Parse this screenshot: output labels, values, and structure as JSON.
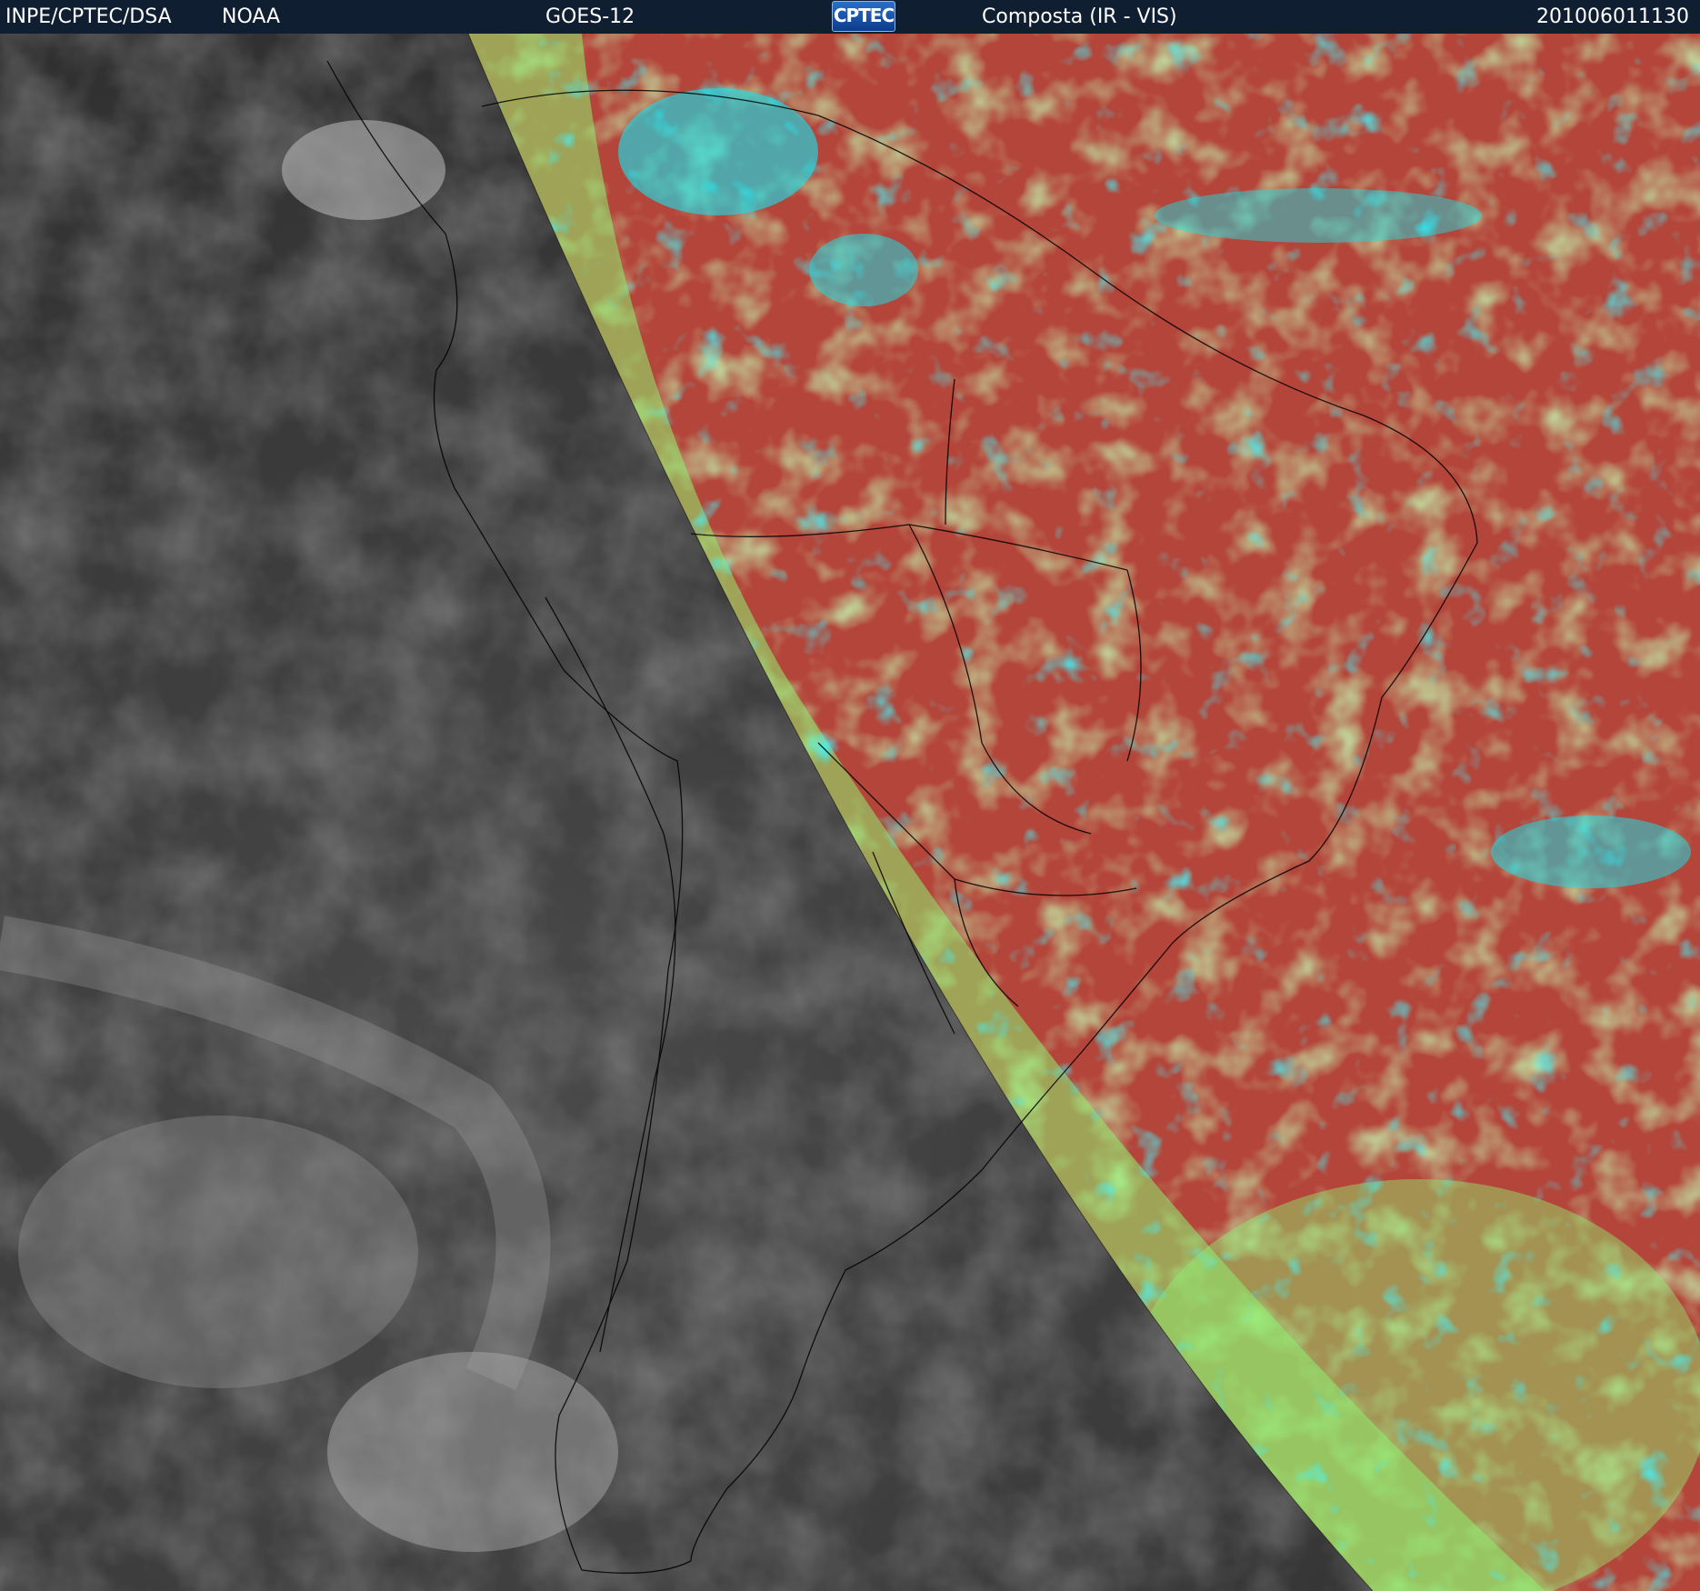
{
  "header": {
    "agency": "INPE/CPTEC/DSA",
    "provider": "NOAA",
    "satellite": "GOES-12",
    "logo_text": "CPTEC",
    "product": "Composta (IR - VIS)",
    "timestamp": "201006011130"
  },
  "colors": {
    "header_bg": "#0f1e30",
    "header_text": "#ffffff",
    "ir_night_gray": "#3c3c3c",
    "composite_red": "#b4453a",
    "composite_green": "#8ef070",
    "composite_cyan": "#10e6f2",
    "boundary_lines": "#000000"
  },
  "map": {
    "left_region": "infrared grayscale",
    "right_region": "IR-VIS color composite",
    "terminator": "curved day/night boundary"
  }
}
